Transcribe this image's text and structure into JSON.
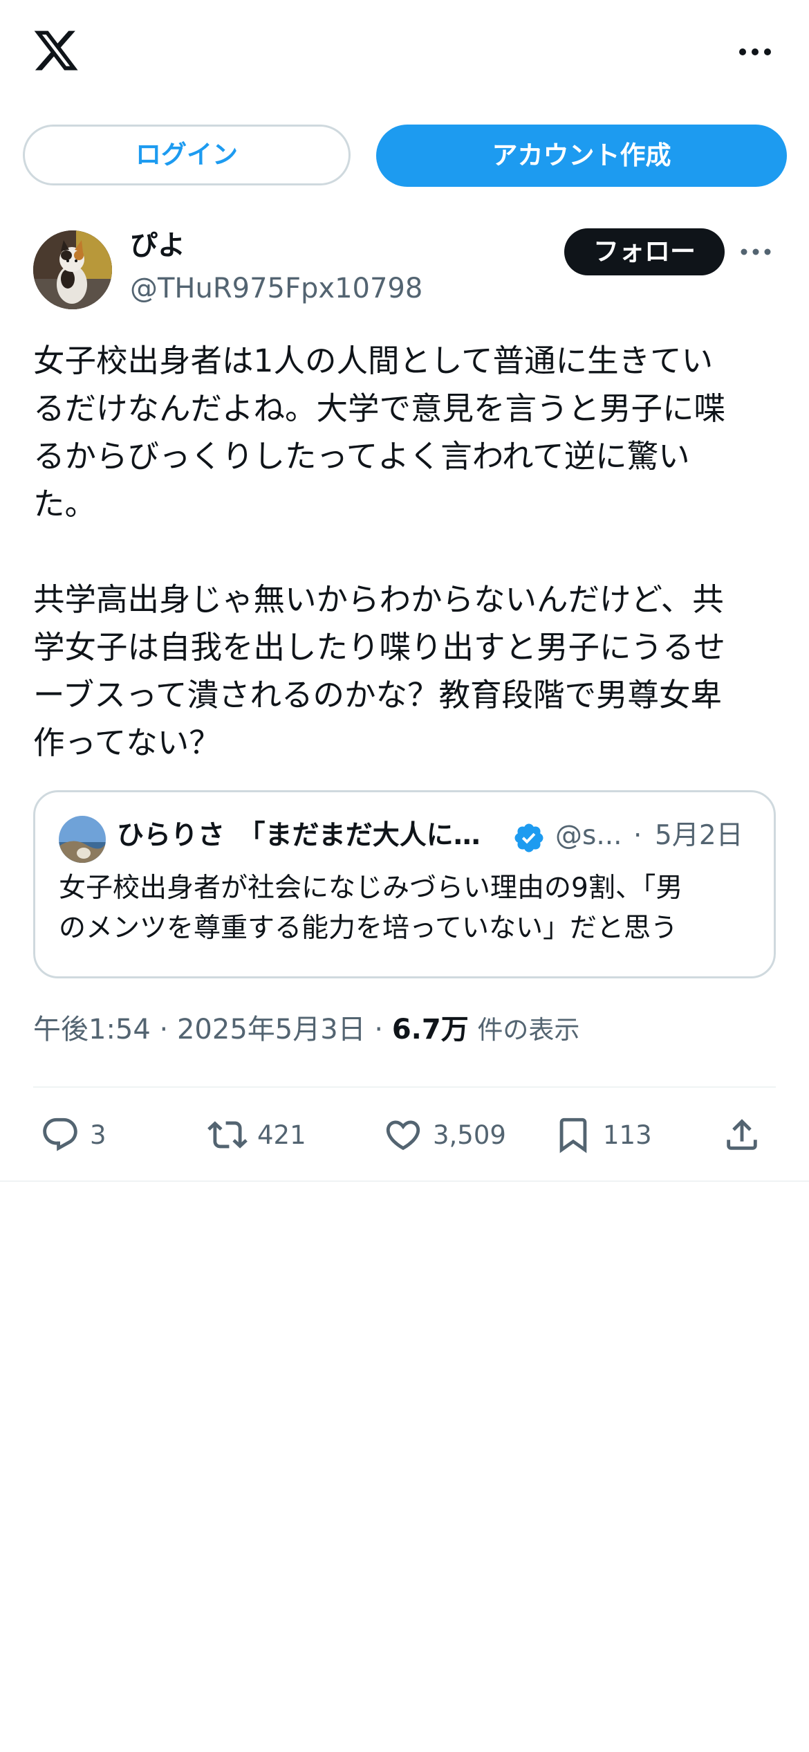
{
  "header": {
    "logo_icon": "x-logo-icon",
    "more_icon": "more-horizontal-icon"
  },
  "auth": {
    "login_label": "ログイン",
    "signup_label": "アカウント作成",
    "accent": "#1d9bf0"
  },
  "tweet": {
    "author_name": "ぴよ",
    "author_handle": "@THuR975Fpx10798",
    "follow_label": "フォロー",
    "text": "女子校出身者は1人の人間として普通に生きてい\nるだけなんだよね。大学で意見を言うと男子に喋\nるからびっくりしたってよく言われて逆に驚い\nた。\n\n共学高出身じゃ無いからわからないんだけど、共\n学女子は自我を出したり喋り出すと男子にうるせ\nーブスって潰されるのかな？教育段階で男尊女卑\n作ってない？",
    "time": "午後1:54",
    "date": "2025年5月3日",
    "separator": "·",
    "views_count": "6.7万",
    "views_label": "件の表示"
  },
  "quote": {
    "name": "ひらりさ　「まだまだ大人になれません」",
    "handle": "@s...",
    "separator": "·",
    "date": "5月2日",
    "text": "女子校出身者が社会になじみづらい理由の9割、「男\nのメンツを尊重する能力を培っていない」だと思う",
    "verified_color": "#1d9bf0"
  },
  "actions": {
    "replies": "3",
    "retweets": "421",
    "likes": "3,509",
    "bookmarks": "113",
    "icons": [
      "reply-icon",
      "retweet-icon",
      "like-icon",
      "bookmark-icon",
      "share-icon"
    ]
  }
}
